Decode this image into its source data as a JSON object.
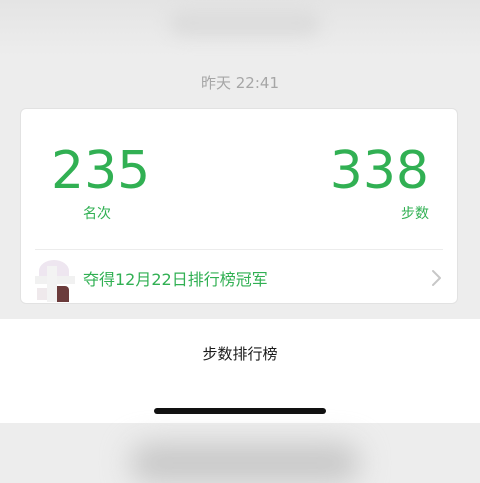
{
  "chat": {
    "timestamp": "昨天 22:41"
  },
  "ranking_card": {
    "rank_value": "235",
    "rank_label": "名次",
    "steps_value": "338",
    "steps_label": "步数",
    "champion_text": "夺得12月22日排行榜冠军"
  },
  "action_sheet": {
    "title": "步数排行榜"
  },
  "colors": {
    "accent_green": "#31b053",
    "timestamp_gray": "#a6a6a6"
  },
  "icons": {
    "row_chevron": "chevron-right-icon",
    "user_avatar": "avatar"
  }
}
